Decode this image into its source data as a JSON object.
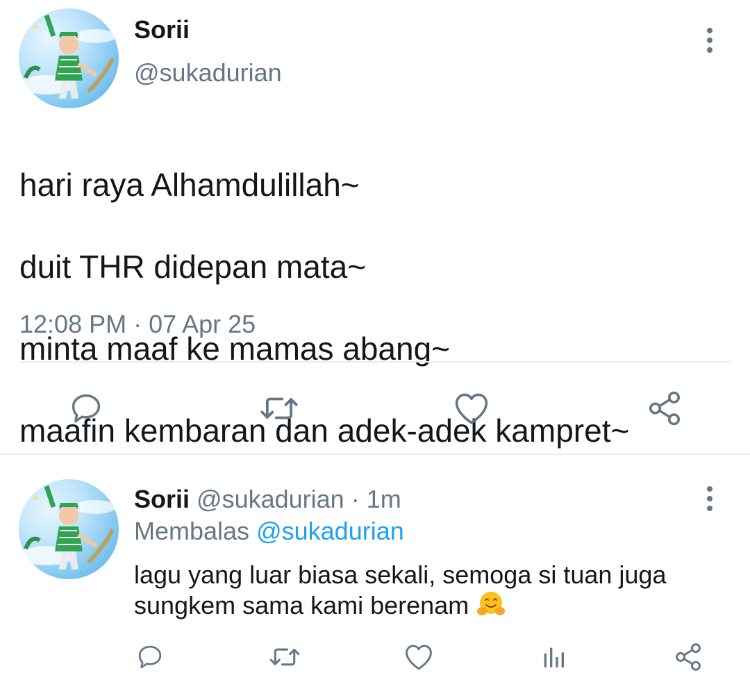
{
  "main_tweet": {
    "author": {
      "name": "Sorii",
      "handle": "@sukadurian"
    },
    "lines": [
      "hari raya Alhamdulillah~",
      "duit THR didepan mata~",
      "minta maaf ke mamas abang~",
      "maafin kembaran dan adek-adek kampret~"
    ],
    "timestamp": "12:08 PM · 07 Apr 25",
    "actions": [
      "reply-icon",
      "retweet-icon",
      "like-icon",
      "share-icon"
    ]
  },
  "reply_tweet": {
    "author": {
      "name": "Sorii",
      "handle": "@sukadurian"
    },
    "meta_separator": " · ",
    "time_ago": "1m",
    "replying_label": "Membalas",
    "replying_to": "@sukadurian",
    "text_line1": "lagu yang luar biasa sekali, semoga si tuan juga",
    "text_line2": "sungkem sama kami berenam",
    "emoji": "hugging-face-emoji",
    "actions": [
      "reply-icon",
      "retweet-icon",
      "like-icon",
      "analytics-icon",
      "share-icon"
    ]
  },
  "colors": {
    "text_primary": "#14171a",
    "text_secondary": "#657786",
    "link": "#1da1f2",
    "divider": "#e6ecf0"
  }
}
